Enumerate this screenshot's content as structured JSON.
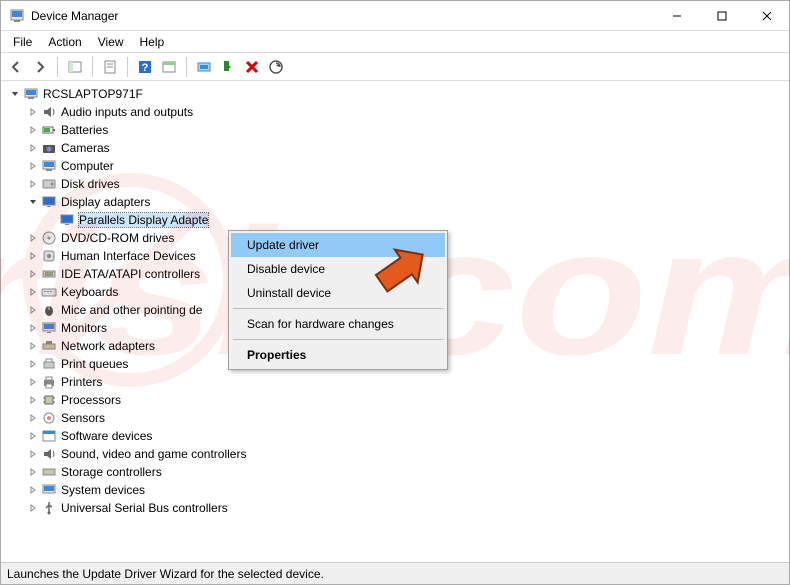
{
  "window": {
    "title": "Device Manager"
  },
  "menu": {
    "file": "File",
    "action": "Action",
    "view": "View",
    "help": "Help"
  },
  "tree": {
    "root": "RCSLAPTOP971F",
    "items": [
      "Audio inputs and outputs",
      "Batteries",
      "Cameras",
      "Computer",
      "Disk drives",
      "Display adapters",
      "DVD/CD-ROM drives",
      "Human Interface Devices",
      "IDE ATA/ATAPI controllers",
      "Keyboards",
      "Mice and other pointing de",
      "Monitors",
      "Network adapters",
      "Print queues",
      "Printers",
      "Processors",
      "Sensors",
      "Software devices",
      "Sound, video and game controllers",
      "Storage controllers",
      "System devices",
      "Universal Serial Bus controllers"
    ],
    "selected_child": "Parallels Display Adapte"
  },
  "context_menu": {
    "update": "Update driver",
    "disable": "Disable device",
    "uninstall": "Uninstall device",
    "scan": "Scan for hardware changes",
    "properties": "Properties"
  },
  "status": "Launches the Update Driver Wizard for the selected device.",
  "watermark": "risk.com"
}
